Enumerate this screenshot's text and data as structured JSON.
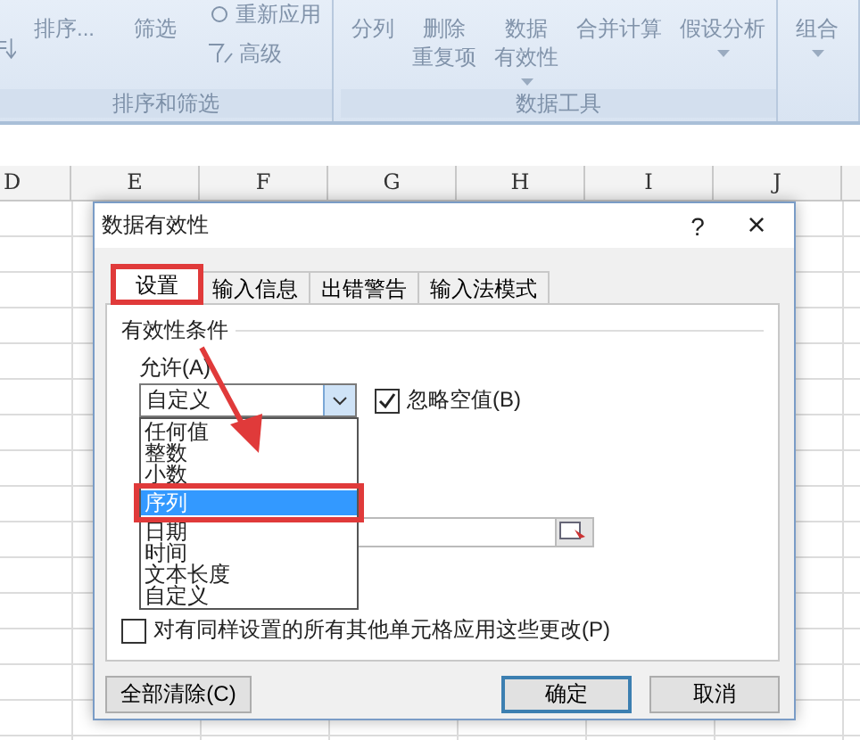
{
  "ribbon": {
    "groups": [
      {
        "label": "排序和筛选",
        "sort_label": "排序...",
        "filter_label": "筛选",
        "reapply_label": "重新应用",
        "advanced_label": "高级"
      },
      {
        "label": "数据工具",
        "items": [
          {
            "kind": "single",
            "lines": [
              "分列"
            ]
          },
          {
            "kind": "single",
            "lines": [
              "删除",
              "重复项"
            ]
          },
          {
            "kind": "menu",
            "lines": [
              "数据",
              "有效性"
            ]
          },
          {
            "kind": "single",
            "lines": [
              "合并计算"
            ]
          },
          {
            "kind": "menu",
            "lines": [
              "假设分析"
            ]
          }
        ]
      },
      {
        "items": [
          {
            "kind": "menu",
            "lines": [
              "组合"
            ]
          }
        ]
      }
    ]
  },
  "sheet": {
    "columns": [
      "D",
      "E",
      "F",
      "G",
      "H",
      "I",
      "J"
    ]
  },
  "dialog": {
    "title": "数据有效性",
    "help": "?",
    "close": "×",
    "tabs": [
      {
        "label": "设置",
        "selected": true
      },
      {
        "label": "输入信息",
        "selected": false
      },
      {
        "label": "出错警告",
        "selected": false
      },
      {
        "label": "输入法模式",
        "selected": false
      }
    ],
    "section": "有效性条件",
    "allow_label": "允许(A)",
    "allow_value": "自定义",
    "ignore_blank": {
      "label": "忽略空值(B)",
      "checked": true
    },
    "options": [
      {
        "label": "任何值",
        "selected": false
      },
      {
        "label": "整数",
        "selected": false
      },
      {
        "label": "小数",
        "selected": false
      },
      {
        "label": "序列",
        "selected": true
      },
      {
        "label": "日期",
        "selected": false
      },
      {
        "label": "时间",
        "selected": false
      },
      {
        "label": "文本长度",
        "selected": false
      },
      {
        "label": "自定义",
        "selected": false
      }
    ],
    "apply_all": {
      "label": "对有同样设置的所有其他单元格应用这些更改(P)",
      "checked": false
    },
    "buttons": [
      {
        "label": "全部清除(C)",
        "kind": "left"
      },
      {
        "label": "确定",
        "kind": "default"
      },
      {
        "label": "取消",
        "kind": "normal"
      }
    ]
  }
}
